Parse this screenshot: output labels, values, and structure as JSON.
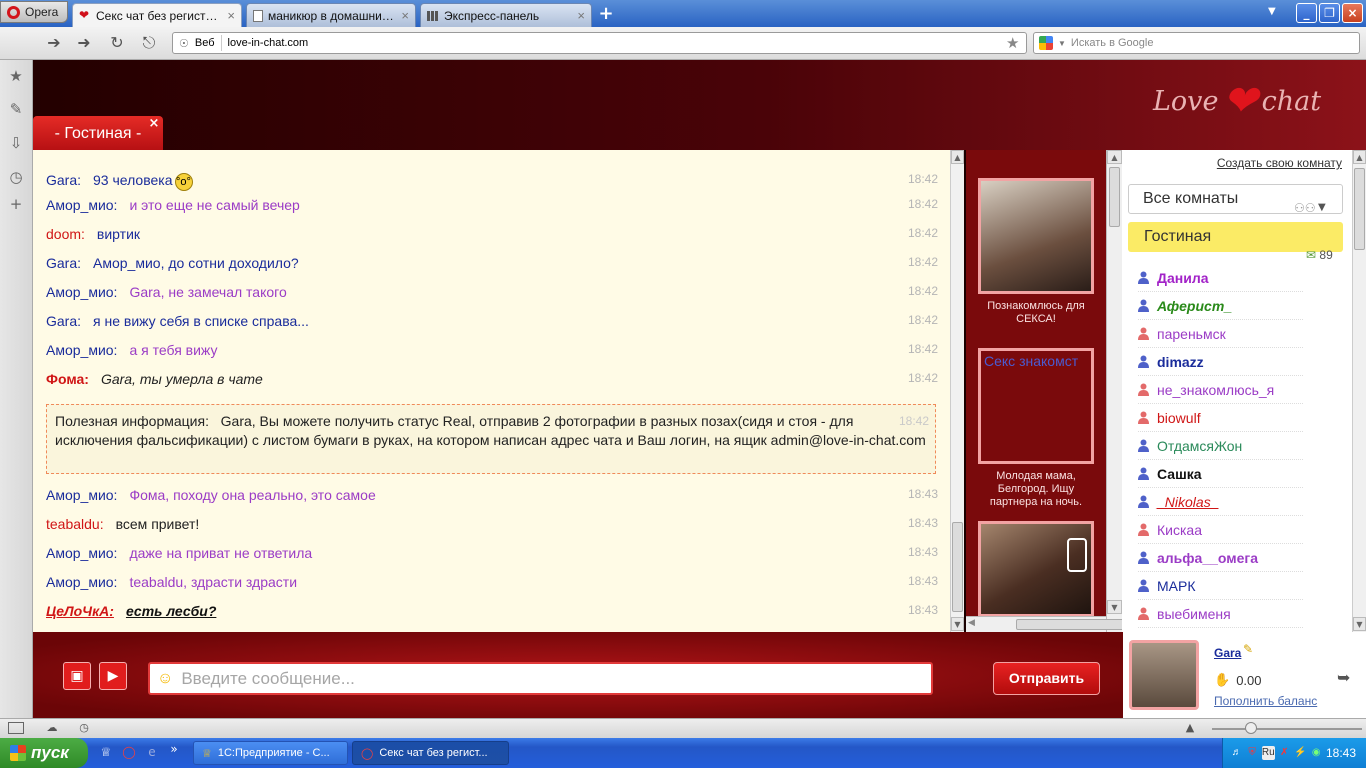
{
  "browser": {
    "menu_label": "Opera",
    "tabs": [
      {
        "title": "Секс чат без регистрац...",
        "active": true,
        "icon": "heart-icon"
      },
      {
        "title": "маникюр в домашних у...",
        "active": false,
        "icon": "document-icon"
      },
      {
        "title": "Экспресс-панель",
        "active": false,
        "icon": "speed-dial-icon"
      }
    ],
    "url_label": "Веб",
    "url": "love-in-chat.com",
    "search_placeholder": "Искать в Google"
  },
  "site": {
    "logo_left": "Love",
    "logo_right": "chat",
    "current_room_tab": "- Гостиная -"
  },
  "chat": {
    "messages": [
      {
        "nick": "Gara:",
        "text": "93 человека",
        "time": "18:42",
        "nick_color": "blue",
        "text_color": "blue",
        "emoji": true
      },
      {
        "nick": "Амор_мио:",
        "text": "и это еще не самый вечер",
        "time": "18:42",
        "nick_color": "blue",
        "text_color": "purple"
      },
      {
        "nick": "doom:",
        "text": "виртик",
        "time": "18:42",
        "nick_color": "red",
        "text_color": "blue"
      },
      {
        "nick": "Gara:",
        "text": "Амор_мио, до сотни доходило?",
        "time": "18:42",
        "nick_color": "blue",
        "text_color": "blue"
      },
      {
        "nick": "Амор_мио:",
        "text": "Gara, не замечал такого",
        "time": "18:42",
        "nick_color": "blue",
        "text_color": "purple"
      },
      {
        "nick": "Gara:",
        "text": "я не вижу себя в списке справа...",
        "time": "18:42",
        "nick_color": "blue",
        "text_color": "blue"
      },
      {
        "nick": "Амор_мио:",
        "text": "а я тебя вижу",
        "time": "18:42",
        "nick_color": "blue",
        "text_color": "purple"
      },
      {
        "nick": "Фома:",
        "text": "Gara, ты умерла в чате",
        "time": "18:42",
        "nick_color": "red-bold",
        "text_color": "dark-italic"
      }
    ],
    "info": {
      "label": "Полезная информация:",
      "text": "Gara, Вы можете получить статус Real, отправив 2 фотографии в разных позах(сидя и стоя - для исключения фальсификации) с листом бумаги в руках, на котором написан адрес чата и Ваш логин, на ящик admin@love-in-chat.com",
      "time": "18:42"
    },
    "messages_after": [
      {
        "nick": "Амор_мио:",
        "text": "Фома, походу она реально, это самое",
        "time": "18:43",
        "nick_color": "blue",
        "text_color": "purple"
      },
      {
        "nick": "teabaldu:",
        "text": "всем привет!",
        "time": "18:43",
        "nick_color": "red",
        "text_color": "dark"
      },
      {
        "nick": "Амор_мио:",
        "text": "даже на приват не ответила",
        "time": "18:43",
        "nick_color": "blue",
        "text_color": "purple"
      },
      {
        "nick": "Амор_мио:",
        "text": "teabaldu, здрасти здрасти",
        "time": "18:43",
        "nick_color": "blue",
        "text_color": "purple"
      },
      {
        "nick": "ЦеЛоЧкА:",
        "text": "есть лесби?",
        "time": "18:43",
        "nick_color": "red-bold-italic",
        "text_color": "dark-bold-italic"
      }
    ],
    "input_placeholder": "Введите сообщение...",
    "send_label": "Отправить"
  },
  "ads": [
    {
      "caption": "Познакомлюсь для СЕКСА!"
    },
    {
      "image_text": "Секс знакомст",
      "caption": "Молодая мама, Белгород. Ищу партнера на ночь."
    },
    {
      "caption": ""
    }
  ],
  "sidebar": {
    "create_room": "Создать свою комнату",
    "room_select": "Все комнаты",
    "current_room": "Гостиная",
    "room_count": "89",
    "users": [
      {
        "name": "Данила",
        "gender": "m",
        "color": "#a222c8",
        "bold": true
      },
      {
        "name": "Аферист_",
        "gender": "m",
        "color": "#2a8a1a",
        "bold": true,
        "italic": true
      },
      {
        "name": "пареньмск",
        "gender": "f",
        "color": "#9b3cc6"
      },
      {
        "name": "dimazz",
        "gender": "m",
        "color": "#1a2c9b",
        "bold": true
      },
      {
        "name": "не_знакомлюсь_я",
        "gender": "f",
        "color": "#9b3cc6"
      },
      {
        "name": "biowulf",
        "gender": "f",
        "color": "#d01616"
      },
      {
        "name": "ОтдамсяЖон",
        "gender": "m",
        "color": "#2a8a5a"
      },
      {
        "name": "Сашка",
        "gender": "m",
        "color": "#111",
        "bold": true
      },
      {
        "name": "_Nikolas_",
        "gender": "m",
        "color": "#d01616",
        "italic": true,
        "underline": true
      },
      {
        "name": "Кискаа",
        "gender": "f",
        "color": "#9b3cc6"
      },
      {
        "name": "альфа__омега",
        "gender": "m",
        "color": "#9b3cc6",
        "bold": true
      },
      {
        "name": "МАРК",
        "gender": "m",
        "color": "#1a2c9b"
      },
      {
        "name": "выебименя",
        "gender": "f",
        "color": "#9b3cc6"
      }
    ]
  },
  "profile": {
    "name": "Gara",
    "balance": "0.00",
    "topup_label": "Пополнить баланс"
  },
  "taskbar": {
    "start_label": "пуск",
    "tasks": [
      {
        "title": "1С:Предприятие - С...",
        "active": false
      },
      {
        "title": "Секс чат без регист...",
        "active": true
      }
    ],
    "lang": "Ru",
    "clock": "18:43"
  }
}
